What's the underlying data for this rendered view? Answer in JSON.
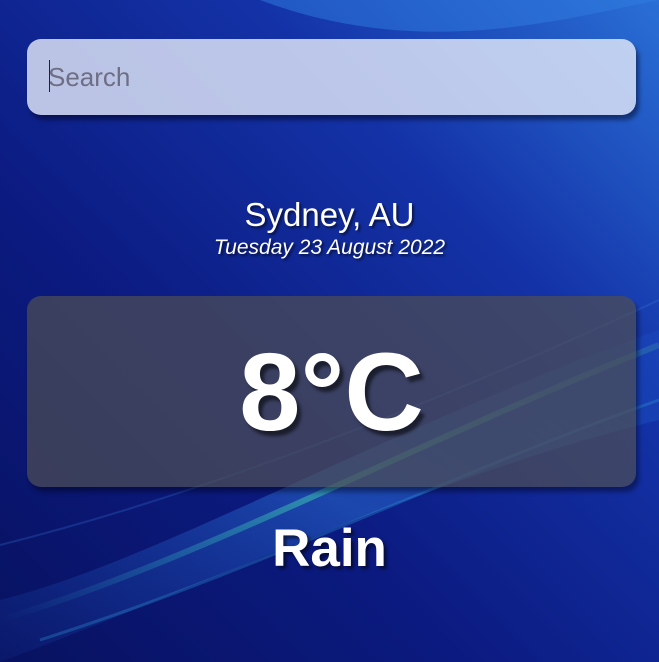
{
  "search": {
    "value": "",
    "placeholder": "Search"
  },
  "location": {
    "name": "Sydney, AU",
    "date": "Tuesday 23 August 2022"
  },
  "weather": {
    "temperature": "8°C",
    "condition": "Rain"
  },
  "colors": {
    "background_dark": "#0a1570",
    "background_light": "#1f5fc8",
    "wave_accent": "#3fae8a",
    "text": "#ffffff"
  }
}
